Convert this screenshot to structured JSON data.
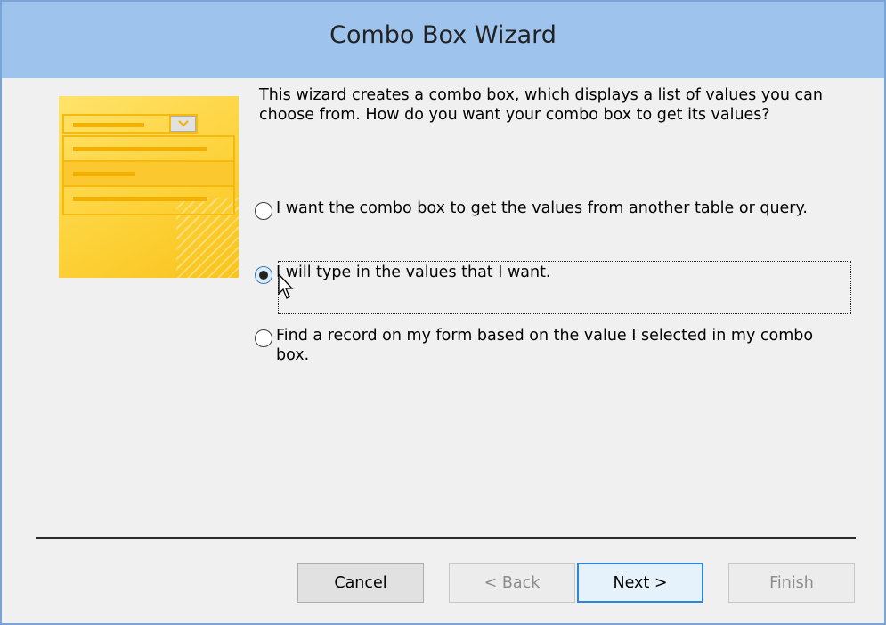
{
  "window": {
    "title": "Combo Box Wizard"
  },
  "illustration": {
    "icon": "combo-box-list-illustration"
  },
  "description": "This wizard creates a combo box, which displays a list of values you can choose from.  How do you want your combo box to get its values?",
  "options": [
    {
      "label": "I want the combo box to get the values from another table or query.",
      "selected": false
    },
    {
      "label": "I will type in the values that I want.",
      "selected": true
    },
    {
      "label": "Find a record on my form based on the value I selected in my combo box.",
      "selected": false
    }
  ],
  "buttons": {
    "cancel": "Cancel",
    "back": "< Back",
    "next": "Next >",
    "finish": "Finish"
  },
  "colors": {
    "titlebar": "#9ec4ee",
    "accent": "#2f86d8"
  }
}
